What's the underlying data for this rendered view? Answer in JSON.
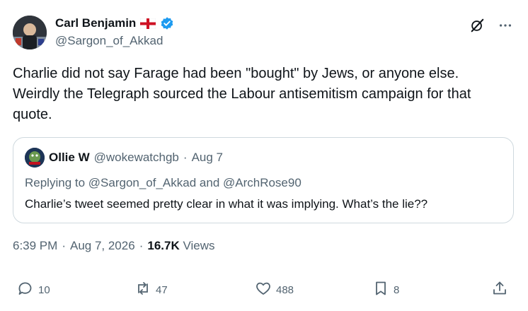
{
  "author": {
    "name": "Carl Benjamin",
    "handle": "@Sargon_of_Akkad",
    "flag_icon": "england-flag-icon",
    "verified_icon": "verified-badge-icon",
    "verified_color": "#1d9bf0"
  },
  "top_actions": {
    "grok_icon": "grok-icon",
    "more_icon": "more-horizontal-icon"
  },
  "post": {
    "text": "Charlie did not say Farage had been \"bought\" by Jews, or anyone else. Weirdly the Telegraph sourced the Labour antisemitism campaign for that quote."
  },
  "quote": {
    "name": "Ollie W",
    "handle": "@wokewatchgb",
    "separator": "·",
    "date": "Aug 7",
    "replying_to": "Replying to @Sargon_of_Akkad and @ArchRose90",
    "text": "Charlie’s tweet seemed pretty clear in what it was implying. What’s the lie??"
  },
  "meta": {
    "time": "6:39 PM",
    "sep1": "·",
    "date": "Aug 7, 2026",
    "sep2": "·",
    "views_count": "16.7K",
    "views_label": "Views"
  },
  "actions": {
    "replies": "10",
    "reposts": "47",
    "likes": "488",
    "bookmarks": "8"
  },
  "colors": {
    "text": "#0f1419",
    "secondary": "#536471",
    "border": "#cfd9de",
    "flag_red": "#ce1124"
  }
}
